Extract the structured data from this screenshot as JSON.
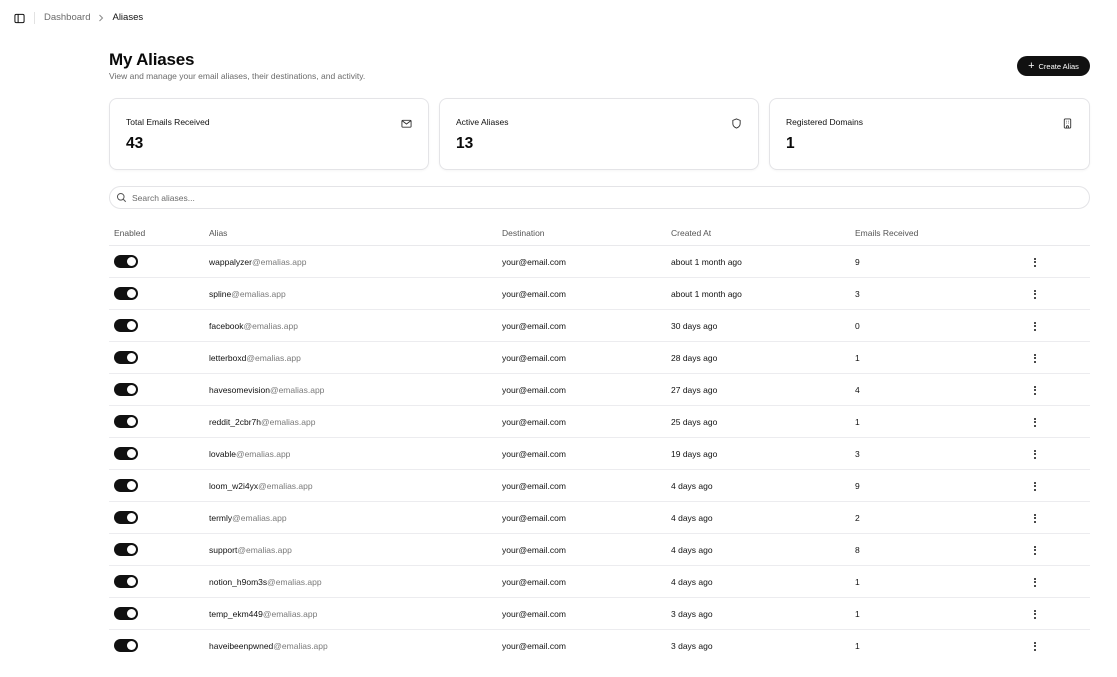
{
  "breadcrumb": {
    "parent": "Dashboard",
    "current": "Aliases"
  },
  "header": {
    "title": "My Aliases",
    "subtitle": "View and manage your email aliases, their destinations, and activity.",
    "create_label": "Create Alias"
  },
  "stats": [
    {
      "label": "Total Emails Received",
      "value": "43",
      "icon": "mail-icon"
    },
    {
      "label": "Active Aliases",
      "value": "13",
      "icon": "shield-icon"
    },
    {
      "label": "Registered Domains",
      "value": "1",
      "icon": "building-icon"
    }
  ],
  "search": {
    "placeholder": "Search aliases..."
  },
  "table": {
    "columns": [
      "Enabled",
      "Alias",
      "Destination",
      "Created At",
      "Emails Received"
    ],
    "rows": [
      {
        "enabled": true,
        "alias_user": "wappalyzer",
        "alias_domain": "@emalias.app",
        "destination": "your@email.com",
        "created": "about 1 month ago",
        "count": "9"
      },
      {
        "enabled": true,
        "alias_user": "spline",
        "alias_domain": "@emalias.app",
        "destination": "your@email.com",
        "created": "about 1 month ago",
        "count": "3"
      },
      {
        "enabled": true,
        "alias_user": "facebook",
        "alias_domain": "@emalias.app",
        "destination": "your@email.com",
        "created": "30 days ago",
        "count": "0"
      },
      {
        "enabled": true,
        "alias_user": "letterboxd",
        "alias_domain": "@emalias.app",
        "destination": "your@email.com",
        "created": "28 days ago",
        "count": "1"
      },
      {
        "enabled": true,
        "alias_user": "havesomevision",
        "alias_domain": "@emalias.app",
        "destination": "your@email.com",
        "created": "27 days ago",
        "count": "4"
      },
      {
        "enabled": true,
        "alias_user": "reddit_2cbr7h",
        "alias_domain": "@emalias.app",
        "destination": "your@email.com",
        "created": "25 days ago",
        "count": "1"
      },
      {
        "enabled": true,
        "alias_user": "lovable",
        "alias_domain": "@emalias.app",
        "destination": "your@email.com",
        "created": "19 days ago",
        "count": "3"
      },
      {
        "enabled": true,
        "alias_user": "loom_w2i4yx",
        "alias_domain": "@emalias.app",
        "destination": "your@email.com",
        "created": "4 days ago",
        "count": "9"
      },
      {
        "enabled": true,
        "alias_user": "termly",
        "alias_domain": "@emalias.app",
        "destination": "your@email.com",
        "created": "4 days ago",
        "count": "2"
      },
      {
        "enabled": true,
        "alias_user": "support",
        "alias_domain": "@emalias.app",
        "destination": "your@email.com",
        "created": "4 days ago",
        "count": "8"
      },
      {
        "enabled": true,
        "alias_user": "notion_h9om3s",
        "alias_domain": "@emalias.app",
        "destination": "your@email.com",
        "created": "4 days ago",
        "count": "1"
      },
      {
        "enabled": true,
        "alias_user": "temp_ekm449",
        "alias_domain": "@emalias.app",
        "destination": "your@email.com",
        "created": "3 days ago",
        "count": "1"
      },
      {
        "enabled": true,
        "alias_user": "haveibeenpwned",
        "alias_domain": "@emalias.app",
        "destination": "your@email.com",
        "created": "3 days ago",
        "count": "1"
      }
    ]
  },
  "colors": {
    "primary": "#111111",
    "muted": "#6b6b6b",
    "border": "#e4e4e7"
  }
}
